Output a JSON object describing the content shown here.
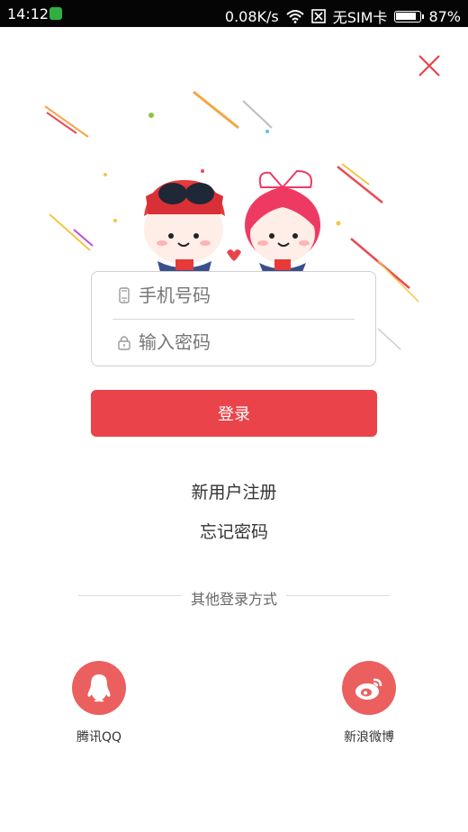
{
  "status_bar": {
    "time": "14:12",
    "network_speed": "0.08K/s",
    "sim_status": "无SIM卡",
    "battery_percent": "87%",
    "battery_level": 0.87
  },
  "close_icon": "close-icon",
  "login_form": {
    "phone_placeholder": "手机号码",
    "password_placeholder": "输入密码",
    "phone_value": "",
    "password_value": ""
  },
  "login_button": {
    "label": "登录"
  },
  "links": {
    "register": "新用户注册",
    "forgot_password": "忘记密码"
  },
  "other_login": {
    "label": "其他登录方式",
    "providers": [
      {
        "label": "腾讯QQ",
        "icon": "qq-icon"
      },
      {
        "label": "新浪微博",
        "icon": "weibo-icon"
      }
    ]
  },
  "colors": {
    "accent": "#ea4349",
    "social": "#ec5f5f"
  }
}
